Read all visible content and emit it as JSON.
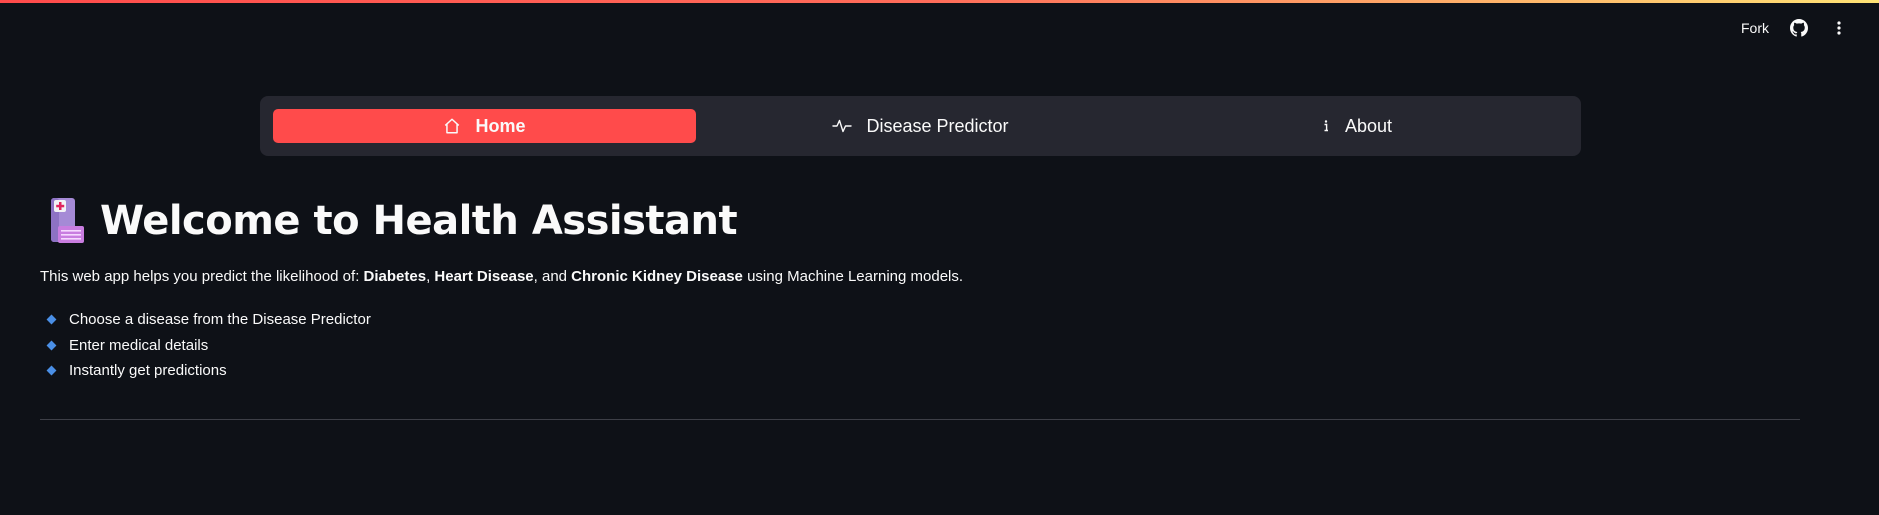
{
  "toolbar": {
    "fork_label": "Fork",
    "github_icon": "github-icon",
    "menu_icon": "kebab-menu-icon"
  },
  "nav": {
    "items": [
      {
        "label": "Home",
        "icon": "home-icon",
        "active": true
      },
      {
        "label": "Disease Predictor",
        "icon": "pulse-icon",
        "active": false
      },
      {
        "label": "About",
        "icon": "info-icon",
        "active": false
      }
    ],
    "accent_color": "#ff4b4b"
  },
  "main": {
    "title_icon": "hospital-emoji-icon",
    "title": "Welcome to Health Assistant",
    "intro": {
      "prefix": "This web app helps you predict the likelihood of: ",
      "disease1": "Diabetes",
      "sep1": ", ",
      "disease2": "Heart Disease",
      "sep2": ", and ",
      "disease3": "Chronic Kidney Disease",
      "suffix": " using Machine Learning models."
    },
    "bullets": [
      "Choose a disease from the Disease Predictor",
      "Enter medical details",
      "Instantly get predictions"
    ],
    "bullet_color": "#4a8fe6"
  },
  "theme": {
    "background": "#0e1117",
    "nav_background": "#262730"
  }
}
